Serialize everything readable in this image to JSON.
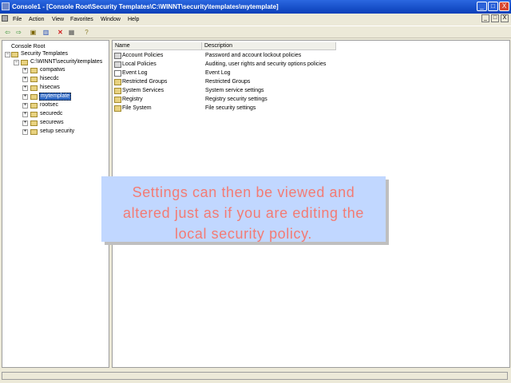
{
  "window": {
    "title": "Console1 - [Console Root\\Security Templates\\C:\\WINNT\\security\\templates\\mytemplate]",
    "buttons": [
      "_",
      "□",
      "X"
    ]
  },
  "menubar": {
    "items": [
      "File",
      "Action",
      "View",
      "Favorites",
      "Window",
      "Help"
    ],
    "mdi_buttons": [
      "_",
      "□",
      "X"
    ]
  },
  "toolbar": {
    "buttons": [
      "back-arrow-icon",
      "forward-arrow-icon",
      "up-folder-icon",
      "console-tree-icon",
      "delete-icon",
      "properties-icon",
      "help-icon"
    ]
  },
  "tree": {
    "items": [
      {
        "label": "Console Root"
      },
      {
        "label": "Security Templates"
      },
      {
        "label": "C:\\WINNT\\security\\templates"
      },
      {
        "label": "compatws"
      },
      {
        "label": "hisecdc"
      },
      {
        "label": "hisecws"
      },
      {
        "label": "mytemplate"
      },
      {
        "label": "rootsec"
      },
      {
        "label": "securedc"
      },
      {
        "label": "securews"
      },
      {
        "label": "setup security"
      }
    ]
  },
  "list": {
    "columns": [
      "Name",
      "Description"
    ],
    "rows": [
      {
        "name": "Account Policies",
        "description": "Password and account lockout policies",
        "icon": "policy-folder-icon"
      },
      {
        "name": "Local Policies",
        "description": "Auditing, user rights and security options policies",
        "icon": "policy-folder-icon"
      },
      {
        "name": "Event Log",
        "description": "Event Log",
        "icon": "event-log-icon"
      },
      {
        "name": "Restricted Groups",
        "description": "Restricted Groups",
        "icon": "folder-icon"
      },
      {
        "name": "System Services",
        "description": "System service settings",
        "icon": "folder-icon"
      },
      {
        "name": "Registry",
        "description": "Registry security settings",
        "icon": "folder-icon"
      },
      {
        "name": "File System",
        "description": "File security settings",
        "icon": "folder-icon"
      }
    ]
  },
  "overlay": {
    "text": "Settings can then be viewed and altered just as if you are editing the local security policy."
  },
  "colors": {
    "titlebar": "#2b67e0",
    "selection": "#316ac5",
    "overlay_background": "#c1d7ff",
    "overlay_text": "#f37b74"
  }
}
